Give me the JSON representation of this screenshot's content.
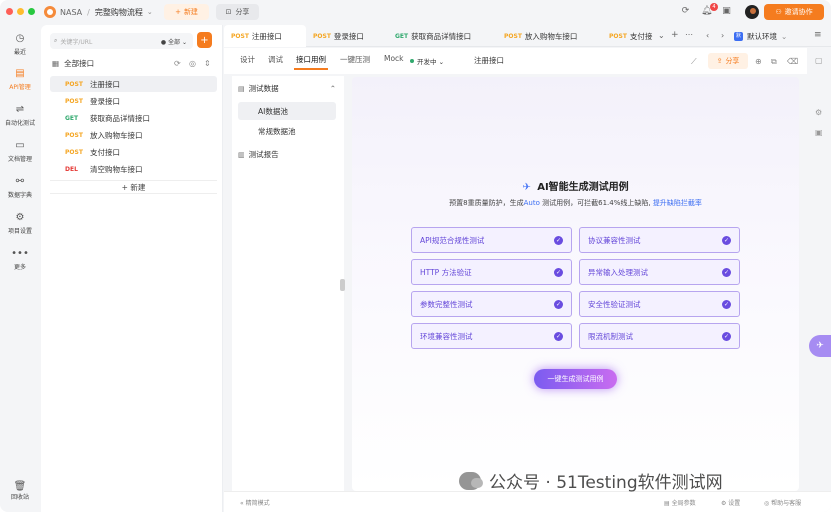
{
  "titlebar": {
    "team": "NASA",
    "project": "完整购物流程",
    "new_label": "新建",
    "share_label": "分享",
    "notification_count": "4",
    "invite_label": "邀请协作"
  },
  "leftnav": {
    "items": [
      {
        "label": "最近",
        "icon": "clock-icon"
      },
      {
        "label": "API管理",
        "icon": "api-icon"
      },
      {
        "label": "自动化测试",
        "icon": "flow-icon"
      },
      {
        "label": "文档管理",
        "icon": "doc-icon"
      },
      {
        "label": "数据字典",
        "icon": "dict-icon"
      },
      {
        "label": "项目设置",
        "icon": "settings-icon"
      },
      {
        "label": "更多",
        "icon": "more-icon"
      }
    ],
    "trash_label": "回收站"
  },
  "apipanel": {
    "search_placeholder": "关键字/URL",
    "filter_label": "全部",
    "root_label": "全部接口",
    "apis": [
      {
        "method": "POST",
        "name": "注册接口"
      },
      {
        "method": "POST",
        "name": "登录接口"
      },
      {
        "method": "GET",
        "name": "获取商品详情接口"
      },
      {
        "method": "POST",
        "name": "放入购物车接口"
      },
      {
        "method": "POST",
        "name": "支付接口"
      },
      {
        "method": "DEL",
        "name": "清空购物车接口"
      }
    ],
    "new_label": "+ 新建"
  },
  "tabs": [
    {
      "method": "POST",
      "name": "注册接口"
    },
    {
      "method": "POST",
      "name": "登录接口"
    },
    {
      "method": "GET",
      "name": "获取商品详情接口"
    },
    {
      "method": "POST",
      "name": "放入购物车接口"
    },
    {
      "method": "POST",
      "name": "支付接"
    }
  ],
  "environment": "默认环境",
  "subbar": {
    "tabs": [
      "设计",
      "调试",
      "接口用例",
      "一键压测",
      "Mock"
    ],
    "env_status": "开发中",
    "api_name": "注册接口",
    "share_label": "分享"
  },
  "testside": {
    "group1": "测试数据",
    "item1": "AI数据池",
    "item2": "常规数据池",
    "group2": "测试报告"
  },
  "main": {
    "title": "AI智能生成测试用例",
    "subtitle_prefix": "预置8重质量防护，生成",
    "subtitle_auto": "Auto",
    "subtitle_mid": " 测试用例，可拦截61.4%线上缺陷, ",
    "subtitle_link": "提升缺陷拦截率",
    "cards": [
      "API规范合规性测试",
      "协议兼容性测试",
      "HTTP 方法验证",
      "异常输入处理测试",
      "参数完整性测试",
      "安全性验证测试",
      "环境兼容性测试",
      "限流机制测试"
    ],
    "generate_label": "一键生成测试用例"
  },
  "statusbar": {
    "left": "精简模式",
    "global_params": "全局参数",
    "settings": "设置",
    "help": "帮助与客服"
  },
  "watermark": "公众号 · 51Testing软件测试网",
  "colors": {
    "accent": "#f57c1f",
    "post": "#f5a623",
    "get": "#31a96e",
    "del": "#e53935",
    "ai_purple": "#6a4de0"
  }
}
